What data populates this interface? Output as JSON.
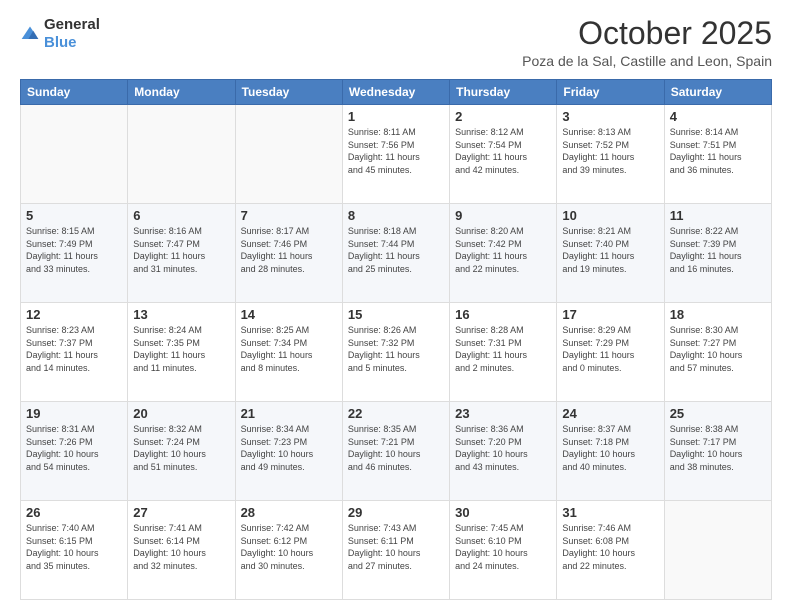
{
  "header": {
    "logo_general": "General",
    "logo_blue": "Blue",
    "month_title": "October 2025",
    "location": "Poza de la Sal, Castille and Leon, Spain"
  },
  "weekdays": [
    "Sunday",
    "Monday",
    "Tuesday",
    "Wednesday",
    "Thursday",
    "Friday",
    "Saturday"
  ],
  "weeks": [
    [
      {
        "day": "",
        "info": ""
      },
      {
        "day": "",
        "info": ""
      },
      {
        "day": "",
        "info": ""
      },
      {
        "day": "1",
        "info": "Sunrise: 8:11 AM\nSunset: 7:56 PM\nDaylight: 11 hours\nand 45 minutes."
      },
      {
        "day": "2",
        "info": "Sunrise: 8:12 AM\nSunset: 7:54 PM\nDaylight: 11 hours\nand 42 minutes."
      },
      {
        "day": "3",
        "info": "Sunrise: 8:13 AM\nSunset: 7:52 PM\nDaylight: 11 hours\nand 39 minutes."
      },
      {
        "day": "4",
        "info": "Sunrise: 8:14 AM\nSunset: 7:51 PM\nDaylight: 11 hours\nand 36 minutes."
      }
    ],
    [
      {
        "day": "5",
        "info": "Sunrise: 8:15 AM\nSunset: 7:49 PM\nDaylight: 11 hours\nand 33 minutes."
      },
      {
        "day": "6",
        "info": "Sunrise: 8:16 AM\nSunset: 7:47 PM\nDaylight: 11 hours\nand 31 minutes."
      },
      {
        "day": "7",
        "info": "Sunrise: 8:17 AM\nSunset: 7:46 PM\nDaylight: 11 hours\nand 28 minutes."
      },
      {
        "day": "8",
        "info": "Sunrise: 8:18 AM\nSunset: 7:44 PM\nDaylight: 11 hours\nand 25 minutes."
      },
      {
        "day": "9",
        "info": "Sunrise: 8:20 AM\nSunset: 7:42 PM\nDaylight: 11 hours\nand 22 minutes."
      },
      {
        "day": "10",
        "info": "Sunrise: 8:21 AM\nSunset: 7:40 PM\nDaylight: 11 hours\nand 19 minutes."
      },
      {
        "day": "11",
        "info": "Sunrise: 8:22 AM\nSunset: 7:39 PM\nDaylight: 11 hours\nand 16 minutes."
      }
    ],
    [
      {
        "day": "12",
        "info": "Sunrise: 8:23 AM\nSunset: 7:37 PM\nDaylight: 11 hours\nand 14 minutes."
      },
      {
        "day": "13",
        "info": "Sunrise: 8:24 AM\nSunset: 7:35 PM\nDaylight: 11 hours\nand 11 minutes."
      },
      {
        "day": "14",
        "info": "Sunrise: 8:25 AM\nSunset: 7:34 PM\nDaylight: 11 hours\nand 8 minutes."
      },
      {
        "day": "15",
        "info": "Sunrise: 8:26 AM\nSunset: 7:32 PM\nDaylight: 11 hours\nand 5 minutes."
      },
      {
        "day": "16",
        "info": "Sunrise: 8:28 AM\nSunset: 7:31 PM\nDaylight: 11 hours\nand 2 minutes."
      },
      {
        "day": "17",
        "info": "Sunrise: 8:29 AM\nSunset: 7:29 PM\nDaylight: 11 hours\nand 0 minutes."
      },
      {
        "day": "18",
        "info": "Sunrise: 8:30 AM\nSunset: 7:27 PM\nDaylight: 10 hours\nand 57 minutes."
      }
    ],
    [
      {
        "day": "19",
        "info": "Sunrise: 8:31 AM\nSunset: 7:26 PM\nDaylight: 10 hours\nand 54 minutes."
      },
      {
        "day": "20",
        "info": "Sunrise: 8:32 AM\nSunset: 7:24 PM\nDaylight: 10 hours\nand 51 minutes."
      },
      {
        "day": "21",
        "info": "Sunrise: 8:34 AM\nSunset: 7:23 PM\nDaylight: 10 hours\nand 49 minutes."
      },
      {
        "day": "22",
        "info": "Sunrise: 8:35 AM\nSunset: 7:21 PM\nDaylight: 10 hours\nand 46 minutes."
      },
      {
        "day": "23",
        "info": "Sunrise: 8:36 AM\nSunset: 7:20 PM\nDaylight: 10 hours\nand 43 minutes."
      },
      {
        "day": "24",
        "info": "Sunrise: 8:37 AM\nSunset: 7:18 PM\nDaylight: 10 hours\nand 40 minutes."
      },
      {
        "day": "25",
        "info": "Sunrise: 8:38 AM\nSunset: 7:17 PM\nDaylight: 10 hours\nand 38 minutes."
      }
    ],
    [
      {
        "day": "26",
        "info": "Sunrise: 7:40 AM\nSunset: 6:15 PM\nDaylight: 10 hours\nand 35 minutes."
      },
      {
        "day": "27",
        "info": "Sunrise: 7:41 AM\nSunset: 6:14 PM\nDaylight: 10 hours\nand 32 minutes."
      },
      {
        "day": "28",
        "info": "Sunrise: 7:42 AM\nSunset: 6:12 PM\nDaylight: 10 hours\nand 30 minutes."
      },
      {
        "day": "29",
        "info": "Sunrise: 7:43 AM\nSunset: 6:11 PM\nDaylight: 10 hours\nand 27 minutes."
      },
      {
        "day": "30",
        "info": "Sunrise: 7:45 AM\nSunset: 6:10 PM\nDaylight: 10 hours\nand 24 minutes."
      },
      {
        "day": "31",
        "info": "Sunrise: 7:46 AM\nSunset: 6:08 PM\nDaylight: 10 hours\nand 22 minutes."
      },
      {
        "day": "",
        "info": ""
      }
    ]
  ]
}
